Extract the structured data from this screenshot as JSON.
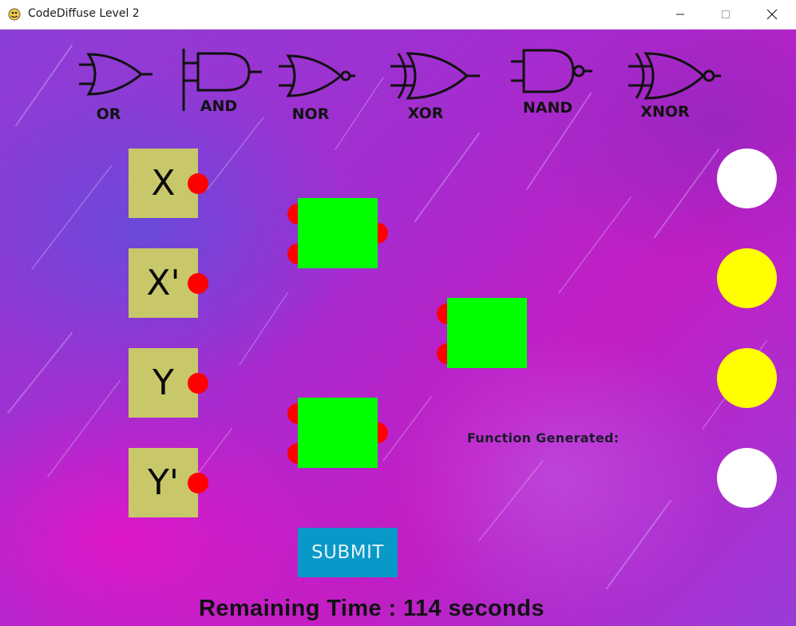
{
  "window": {
    "title": "CodeDiffuse Level 2",
    "icon": "pygame-snake-icon",
    "controls": [
      "minimize-icon",
      "maximize-icon",
      "close-icon"
    ]
  },
  "gate_palette": [
    {
      "name": "OR",
      "icon": "or-gate-icon"
    },
    {
      "name": "AND",
      "icon": "and-gate-icon"
    },
    {
      "name": "NOR",
      "icon": "nor-gate-icon"
    },
    {
      "name": "XOR",
      "icon": "xor-gate-icon"
    },
    {
      "name": "NAND",
      "icon": "nand-gate-icon"
    },
    {
      "name": "XNOR",
      "icon": "xnor-gate-icon"
    }
  ],
  "variables": [
    {
      "label": "X"
    },
    {
      "label": "X'"
    },
    {
      "label": "Y"
    },
    {
      "label": "Y'"
    }
  ],
  "output_lights": [
    {
      "state": "off",
      "color": "#ffffff"
    },
    {
      "state": "on",
      "color": "#ffff00"
    },
    {
      "state": "on",
      "color": "#ffff00"
    },
    {
      "state": "off",
      "color": "#ffffff"
    }
  ],
  "function_generated_label": "Function Generated:",
  "submit_label": "SUBMIT",
  "timer_text": "Remaining Time : 114 seconds",
  "colors": {
    "variable_block": "#c8c86a",
    "gate_slot": "#00ff00",
    "connector_pin": "#ff0000",
    "submit_button": "#0899c8"
  }
}
